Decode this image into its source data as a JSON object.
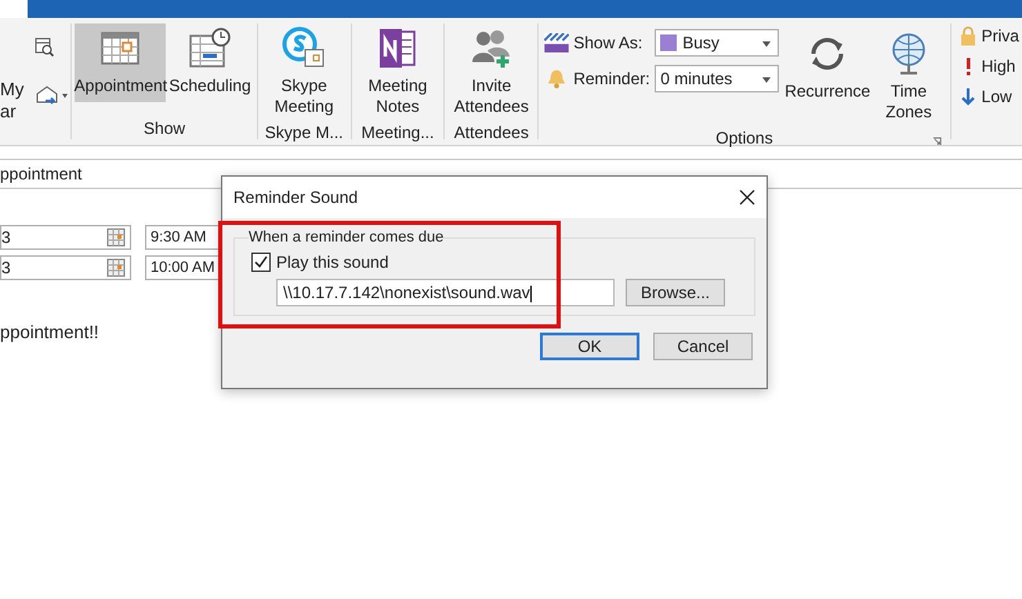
{
  "ribbon": {
    "partial_group": {
      "line_1": "My",
      "line_2": "ar"
    },
    "groups": [
      {
        "kind": "buttons",
        "label": "Show",
        "buttons": [
          {
            "label": "Appointment",
            "kind": "appointment",
            "selected": true
          },
          {
            "label": "Scheduling",
            "kind": "scheduling",
            "selected": false
          }
        ]
      },
      {
        "kind": "buttons",
        "label": "Skype M...",
        "buttons": [
          {
            "label": "Skype Meeting",
            "kind": "skype"
          }
        ]
      },
      {
        "kind": "buttons",
        "label": "Meeting...",
        "buttons": [
          {
            "label": "Meeting Notes",
            "kind": "notes"
          }
        ]
      },
      {
        "kind": "buttons",
        "label": "Attendees",
        "buttons": [
          {
            "label": "Invite Attendees",
            "kind": "invite"
          }
        ]
      },
      {
        "kind": "options",
        "label": "Options",
        "show_as": {
          "label": "Show As:",
          "value": "Busy"
        },
        "reminder": {
          "label": "Reminder:",
          "value": "0 minutes"
        },
        "buttons": [
          {
            "label": "Recurrence",
            "kind": "recurrence"
          },
          {
            "label": "Time Zones",
            "kind": "globe"
          }
        ]
      },
      {
        "kind": "tags",
        "items": [
          {
            "label": "Priva",
            "kind": "lock"
          },
          {
            "label": "High",
            "kind": "high"
          },
          {
            "label": "Low",
            "kind": "low"
          }
        ]
      }
    ]
  },
  "form": {
    "subject": "ppointment",
    "start": {
      "date": "3",
      "time": "9:30 AM"
    },
    "end": {
      "date": "3",
      "time": "10:00 AM"
    },
    "body": "ppointment!!"
  },
  "dialog": {
    "title": "Reminder Sound",
    "group_label": "When a reminder comes due",
    "checkbox": {
      "label": "Play this sound",
      "checked": true
    },
    "path": "\\\\10.17.7.142\\nonexist\\sound.wav",
    "browse": "Browse...",
    "ok": "OK",
    "cancel": "Cancel"
  }
}
